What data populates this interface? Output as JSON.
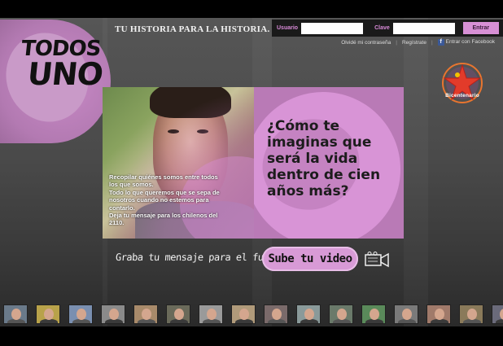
{
  "logo": {
    "line1": "TODOS",
    "line2": "UNO"
  },
  "tagline": "TU HISTORIA PARA LA HISTORIA.",
  "login": {
    "user_label": "Usuario",
    "user_value": "",
    "pass_label": "Clave",
    "pass_value": "",
    "submit_label": "Entrar",
    "forgot_link": "Olvidé mi contraseña",
    "register_link": "Regístrate",
    "separator": "|",
    "facebook_link": "Entrar con Facebook",
    "facebook_glyph": "f"
  },
  "seal": {
    "text": "Bicentenario"
  },
  "feature": {
    "caption_lines": [
      "Recopilar quiénes somos entre todos",
      "los que somos.",
      "Todo lo que queremos que se sepa de",
      "nosotros cuando no estemos para",
      "contarlo.",
      "Deja tu mensaje para los chilenos del",
      "2110."
    ],
    "question": "¿Cómo te imaginas que será la vida dentro de cien años más?"
  },
  "upload": {
    "prompt": "Graba tu mensaje para el futuro",
    "button_label": "Sube tu video"
  },
  "colors": {
    "accent": "#d790d5",
    "panel_pink": "#b97ab6",
    "background": "#4a4a4a",
    "facebook": "#3b5998"
  },
  "thumbnails": [
    {
      "bg": "#6a7a8a"
    },
    {
      "bg": "#b8a24a"
    },
    {
      "bg": "#7a8fb0"
    },
    {
      "bg": "#8a8a8a"
    },
    {
      "bg": "#a88a6a"
    },
    {
      "bg": "#6a6a5a"
    },
    {
      "bg": "#9a9a9a"
    },
    {
      "bg": "#b09a7a"
    },
    {
      "bg": "#7a6a6a"
    },
    {
      "bg": "#8a9a9a"
    },
    {
      "bg": "#6a7a6a"
    },
    {
      "bg": "#5a8a5a"
    },
    {
      "bg": "#7a7a7a"
    },
    {
      "bg": "#a07a6a"
    },
    {
      "bg": "#8a7a5a"
    },
    {
      "bg": "#6a6a7a"
    }
  ]
}
